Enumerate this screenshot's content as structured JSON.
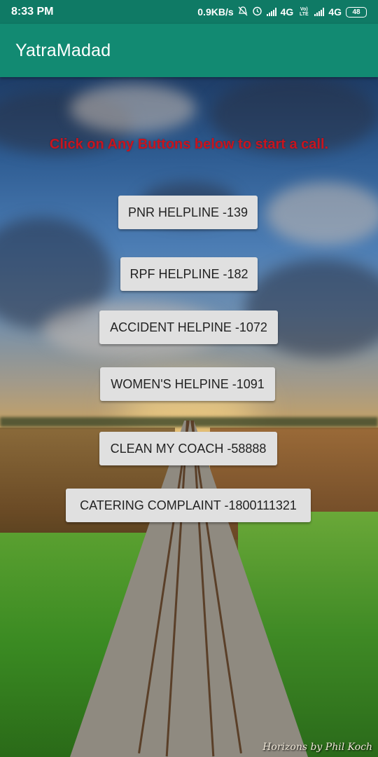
{
  "status_bar": {
    "time": "8:33 PM",
    "speed": "0.9KB/s",
    "icons": [
      "mute-bell-icon",
      "alarm-icon",
      "signal-icon",
      "signal-icon"
    ],
    "net1": "4G",
    "volte": "Vo) LTE",
    "net2": "4G",
    "battery": "48"
  },
  "app_bar": {
    "title": "YatraMadad",
    "color": "#128a72"
  },
  "instruction": "Click on Any Buttons below to start a call.",
  "buttons": [
    {
      "label": "PNR HELPLINE -139"
    },
    {
      "label": "RPF HELPLINE -182"
    },
    {
      "label": "ACCIDENT HELPINE -1072"
    },
    {
      "label": "WOMEN'S HELPINE -1091"
    },
    {
      "label": "CLEAN MY COACH -58888"
    },
    {
      "label": "CATERING COMPLAINT -1800111321"
    }
  ],
  "background": {
    "credit": "Horizons by Phil Koch"
  },
  "colors": {
    "status_bar": "#0f7a65",
    "instruction": "#c8141e",
    "button": "#e0e0e0"
  }
}
